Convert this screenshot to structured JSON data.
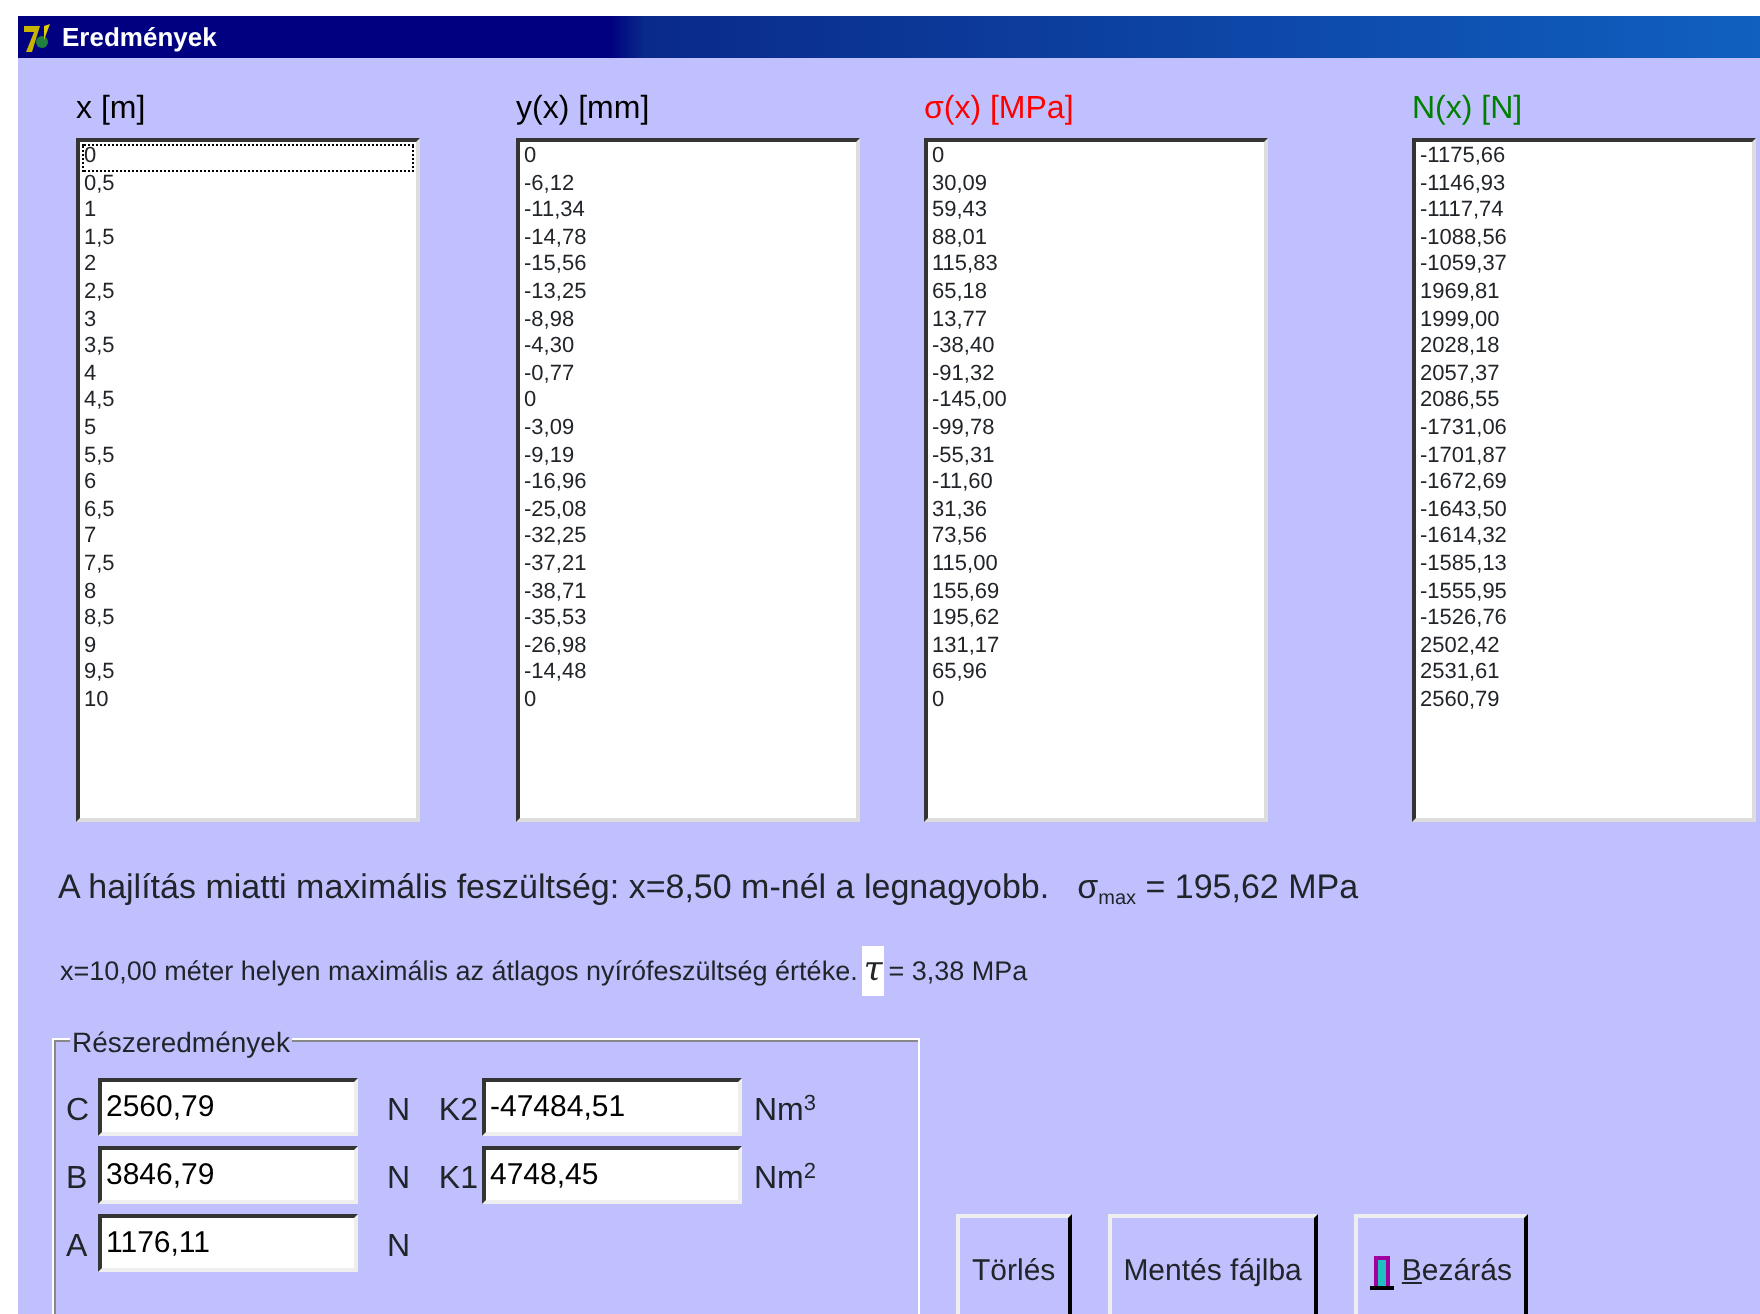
{
  "window": {
    "title": "Eredmények"
  },
  "columns": [
    {
      "heading": "x [m]",
      "color": "#000000",
      "focused": true,
      "items": [
        "0",
        "0,5",
        "1",
        "1,5",
        "2",
        "2,5",
        "3",
        "3,5",
        "4",
        "4,5",
        "5",
        "5,5",
        "6",
        "6,5",
        "7",
        "7,5",
        "8",
        "8,5",
        "9",
        "9,5",
        "10"
      ]
    },
    {
      "heading": "y(x) [mm]",
      "color": "#000000",
      "focused": false,
      "items": [
        "0",
        "-6,12",
        "-11,34",
        "-14,78",
        "-15,56",
        "-13,25",
        "-8,98",
        "-4,30",
        "-0,77",
        "0",
        "-3,09",
        "-9,19",
        "-16,96",
        "-25,08",
        "-32,25",
        "-37,21",
        "-38,71",
        "-35,53",
        "-26,98",
        "-14,48",
        "0"
      ]
    },
    {
      "heading": "σ(x) [MPa]",
      "color": "#ff0000",
      "focused": false,
      "items": [
        "0",
        "30,09",
        "59,43",
        "88,01",
        "115,83",
        "65,18",
        "13,77",
        "-38,40",
        "-91,32",
        "-145,00",
        "-99,78",
        "-55,31",
        "-11,60",
        "31,36",
        "73,56",
        "115,00",
        "155,69",
        "195,62",
        "131,17",
        "65,96",
        "0"
      ]
    },
    {
      "heading": "N(x) [N]",
      "color": "#008000",
      "focused": false,
      "items": [
        "-1175,66",
        "-1146,93",
        "-1117,74",
        "-1088,56",
        "-1059,37",
        "1969,81",
        "1999,00",
        "2028,18",
        "2057,37",
        "2086,55",
        "-1731,06",
        "-1701,87",
        "-1672,69",
        "-1643,50",
        "-1614,32",
        "-1585,13",
        "-1555,95",
        "-1526,76",
        "2502,42",
        "2531,61",
        "2560,79"
      ]
    }
  ],
  "summary": {
    "bending_text": "A hajlítás miatti maximális feszültség: x=8,50 m-nél a legnagyobb.",
    "sigma_max": "σ$_{max}$ = 195,62 MPa",
    "shear_text": "x=10,00 méter helyen maximális az átlagos nyírófeszültség értéke.",
    "tau_symbol": "τ",
    "tau_value": "= 3,38 MPa"
  },
  "partial_results": {
    "title": "Részeredmények",
    "left": [
      {
        "label": "C",
        "value": "2560,79",
        "unit": "N"
      },
      {
        "label": "B",
        "value": "3846,79",
        "unit": "N"
      },
      {
        "label": "A",
        "value": "1176,11",
        "unit": "N"
      }
    ],
    "right": [
      {
        "label": "K2",
        "value": "-47484,51",
        "unit": "Nm$^{3}$"
      },
      {
        "label": "K1",
        "value": "4748,45",
        "unit": "Nm$^{2}$"
      }
    ]
  },
  "buttons": [
    {
      "label": "Törlés",
      "icon": false
    },
    {
      "label": "Mentés fájlba",
      "icon": false
    },
    {
      "label": "Bezárás",
      "icon": true
    }
  ]
}
